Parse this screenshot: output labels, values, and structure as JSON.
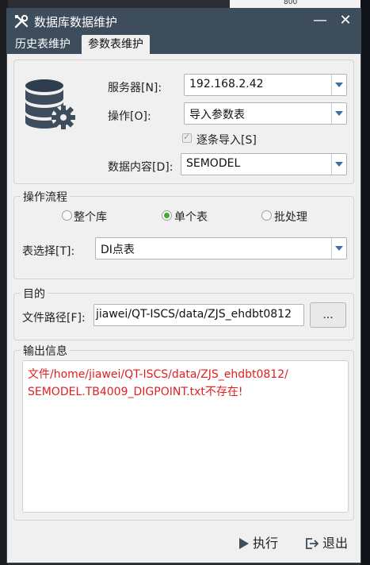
{
  "background": {
    "ruler_tick": "800"
  },
  "window": {
    "title": "数据库数据维护",
    "minimize": "—",
    "close": "✕"
  },
  "tabs": [
    {
      "label": "历史表维护",
      "active": false
    },
    {
      "label": "参数表维护",
      "active": true
    }
  ],
  "server_section": {
    "server_label": "服务器[N]:",
    "server_value": "192.168.2.42",
    "operation_label": "操作[O]:",
    "operation_value": "导入参数表",
    "row_by_row_label": "逐条导入[S]",
    "row_by_row_checked": true,
    "data_content_label": "数据内容[D]:",
    "data_content_value": "SEMODEL"
  },
  "flow_section": {
    "title": "操作流程",
    "radios": [
      {
        "label": "整个库",
        "checked": false
      },
      {
        "label": "单个表",
        "checked": true
      },
      {
        "label": "批处理",
        "checked": false
      }
    ],
    "table_select_label": "表选择[T]:",
    "table_select_value": "DI点表"
  },
  "target_section": {
    "title": "目的",
    "path_label": "文件路径[F]:",
    "path_value": "jiawei/QT-ISCS/data/ZJS_ehdbt0812",
    "browse_label": "..."
  },
  "output_section": {
    "title": "输出信息",
    "message": "文件/home/jiawei/QT-ISCS/data/ZJS_ehdbt0812/\nSEMODEL.TB4009_DIGPOINT.txt不存在!"
  },
  "actions": {
    "execute_label": "执行",
    "exit_label": "退出"
  },
  "colors": {
    "titlebar": "#3d4d5c",
    "error_text": "#e02020",
    "radio_checked": "#3fae2a"
  }
}
